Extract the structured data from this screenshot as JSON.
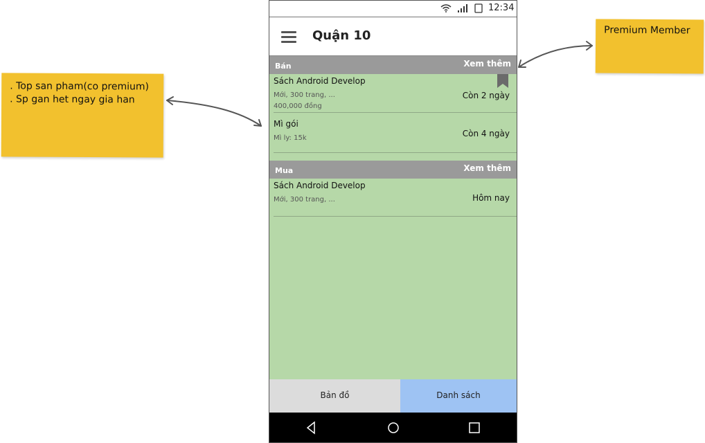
{
  "notes": {
    "left_lines": [
      ". Top san pham(co premium)",
      ". Sp gan het ngay gia han"
    ],
    "right_text": "Premium Member"
  },
  "statusbar": {
    "time": "12:34"
  },
  "appbar": {
    "title": "Quận 10"
  },
  "sections": {
    "sell": {
      "label": "Bán",
      "more": "Xem thêm",
      "items": [
        {
          "name": "Sách Android Develop",
          "desc": "Mới, 300 trang, ...",
          "price": "400,000 đồng",
          "days": "Còn 2 ngày"
        },
        {
          "name": "Mì gói",
          "desc": "Mì ly: 15k",
          "days": "Còn 4 ngày"
        }
      ]
    },
    "buy": {
      "label": "Mua",
      "more": "Xem thêm",
      "items": [
        {
          "name": "Sách Android Develop",
          "desc": "Mới, 300 trang, ...",
          "days": "Hôm nay"
        }
      ]
    }
  },
  "tabs": {
    "map": "Bản đồ",
    "list": "Danh sách"
  },
  "icons": {
    "menu": "hamburger-icon",
    "bookmark": "bookmark-icon",
    "wifi": "wifi-icon",
    "signal": "signal-icon",
    "battery": "battery-icon",
    "back": "back-icon",
    "home": "home-icon",
    "recents": "recents-icon"
  },
  "colors": {
    "note": "#f2c12e",
    "list_bg": "#b6d8a8",
    "section_header": "#9a9a9a",
    "active_tab": "#9ec3f3",
    "inactive_tab": "#dcdcdc"
  }
}
